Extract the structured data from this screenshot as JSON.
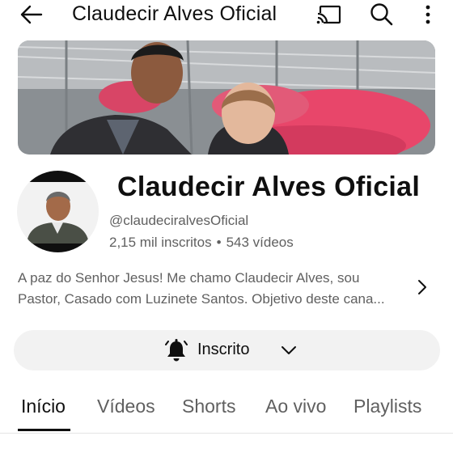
{
  "topbar": {
    "title": "Claudecir Alves Oficial",
    "back_icon": "arrow-left-icon",
    "cast_icon": "cast-icon",
    "search_icon": "search-icon",
    "more_icon": "more-vertical-icon"
  },
  "channel": {
    "name": "Claudecir Alves Oficial",
    "handle": "@claudeciralvesOficial",
    "subscribers": "2,15 mil inscritos",
    "separator": "•",
    "videos": "543 vídeos",
    "description_line1": "A paz do Senhor Jesus! Me chamo Claudecir Alves, sou",
    "description_line2": "Pastor, Casado com Luzinete Santos. Objetivo deste cana..."
  },
  "subscribe_button": {
    "label": "Inscrito",
    "icon": "bell-ringing-icon"
  },
  "tabs": [
    {
      "label": "Início",
      "active": true
    },
    {
      "label": "Vídeos",
      "active": false
    },
    {
      "label": "Shorts",
      "active": false
    },
    {
      "label": "Ao vivo",
      "active": false
    },
    {
      "label": "Playlists",
      "active": false
    }
  ],
  "colors": {
    "text_primary": "#0f0f0f",
    "text_secondary": "#606060",
    "button_bg": "#f2f2f2",
    "flowers": "#e8466a"
  }
}
